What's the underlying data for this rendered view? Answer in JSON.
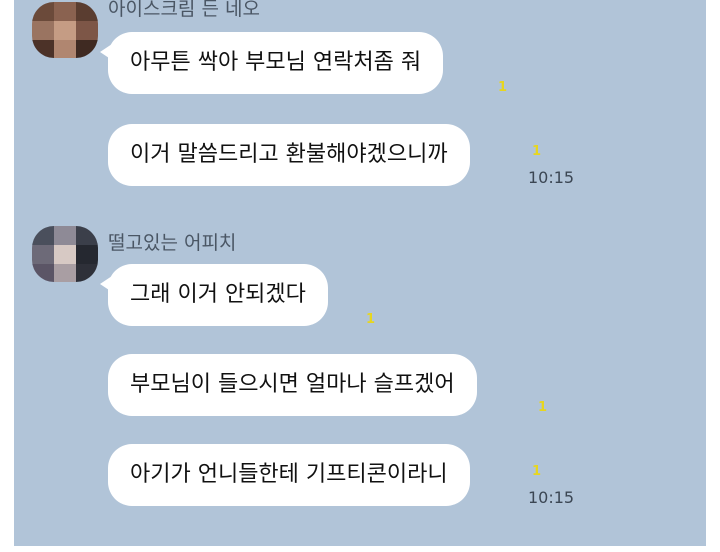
{
  "colors": {
    "chat_background": "#b1c4d8",
    "bubble": "#ffffff",
    "unread_badge": "#e7d61f"
  },
  "messages": [
    {
      "sender": "아이스크림 든 네오",
      "bubbles": [
        {
          "text": "아무튼 싹아 부모님 연락처좀 줘",
          "unread": "1"
        },
        {
          "text": "이거 말씀드리고 환불해야겠으니까",
          "unread": "1",
          "time": "10:15"
        }
      ]
    },
    {
      "sender": "떨고있는 어피치",
      "bubbles": [
        {
          "text": "그래 이거 안되겠다",
          "unread": "1"
        },
        {
          "text": "부모님이 들으시면 얼마나 슬프겠어",
          "unread": "1"
        },
        {
          "text": "아기가 언니들한테 기프티콘이라니",
          "unread": "1",
          "time": "10:15"
        }
      ]
    }
  ]
}
